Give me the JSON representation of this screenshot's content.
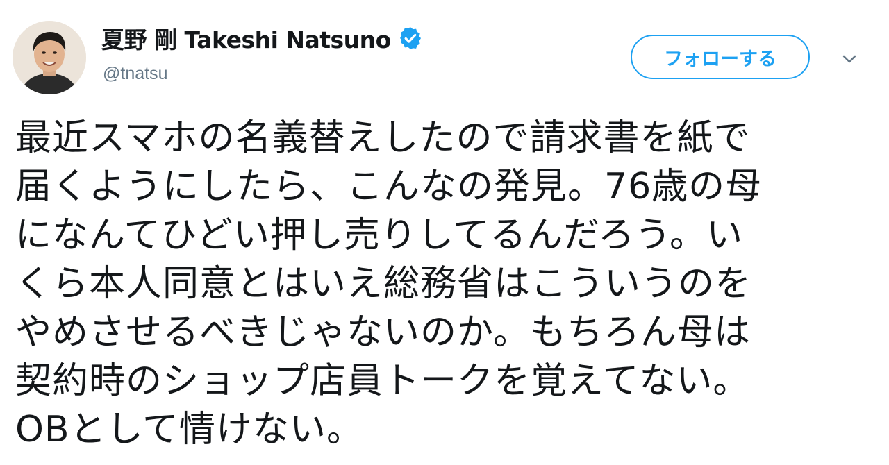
{
  "tweet": {
    "author": {
      "display_name": "夏野 剛 Takeshi Natsuno",
      "handle": "@tnatsu",
      "verified_icon": "verified-badge-icon",
      "avatar_icon": "user-avatar"
    },
    "follow_label": "フォローする",
    "menu_icon": "chevron-down-icon",
    "text_lines": [
      "最近スマホの名義替えしたので請求書を紙で",
      "届くようにしたら、こんなの発見。76歳の母",
      "になんてひどい押し売りしてるんだろう。い",
      "くら本人同意とはいえ総務省はこういうのを",
      "やめさせるべきじゃないのか。もちろん母は",
      "契約時のショップ店員トークを覚えてない。",
      "OBとして情けない。"
    ]
  },
  "colors": {
    "accent": "#1da1f2",
    "text": "#14171a",
    "secondary_text": "#657786"
  }
}
